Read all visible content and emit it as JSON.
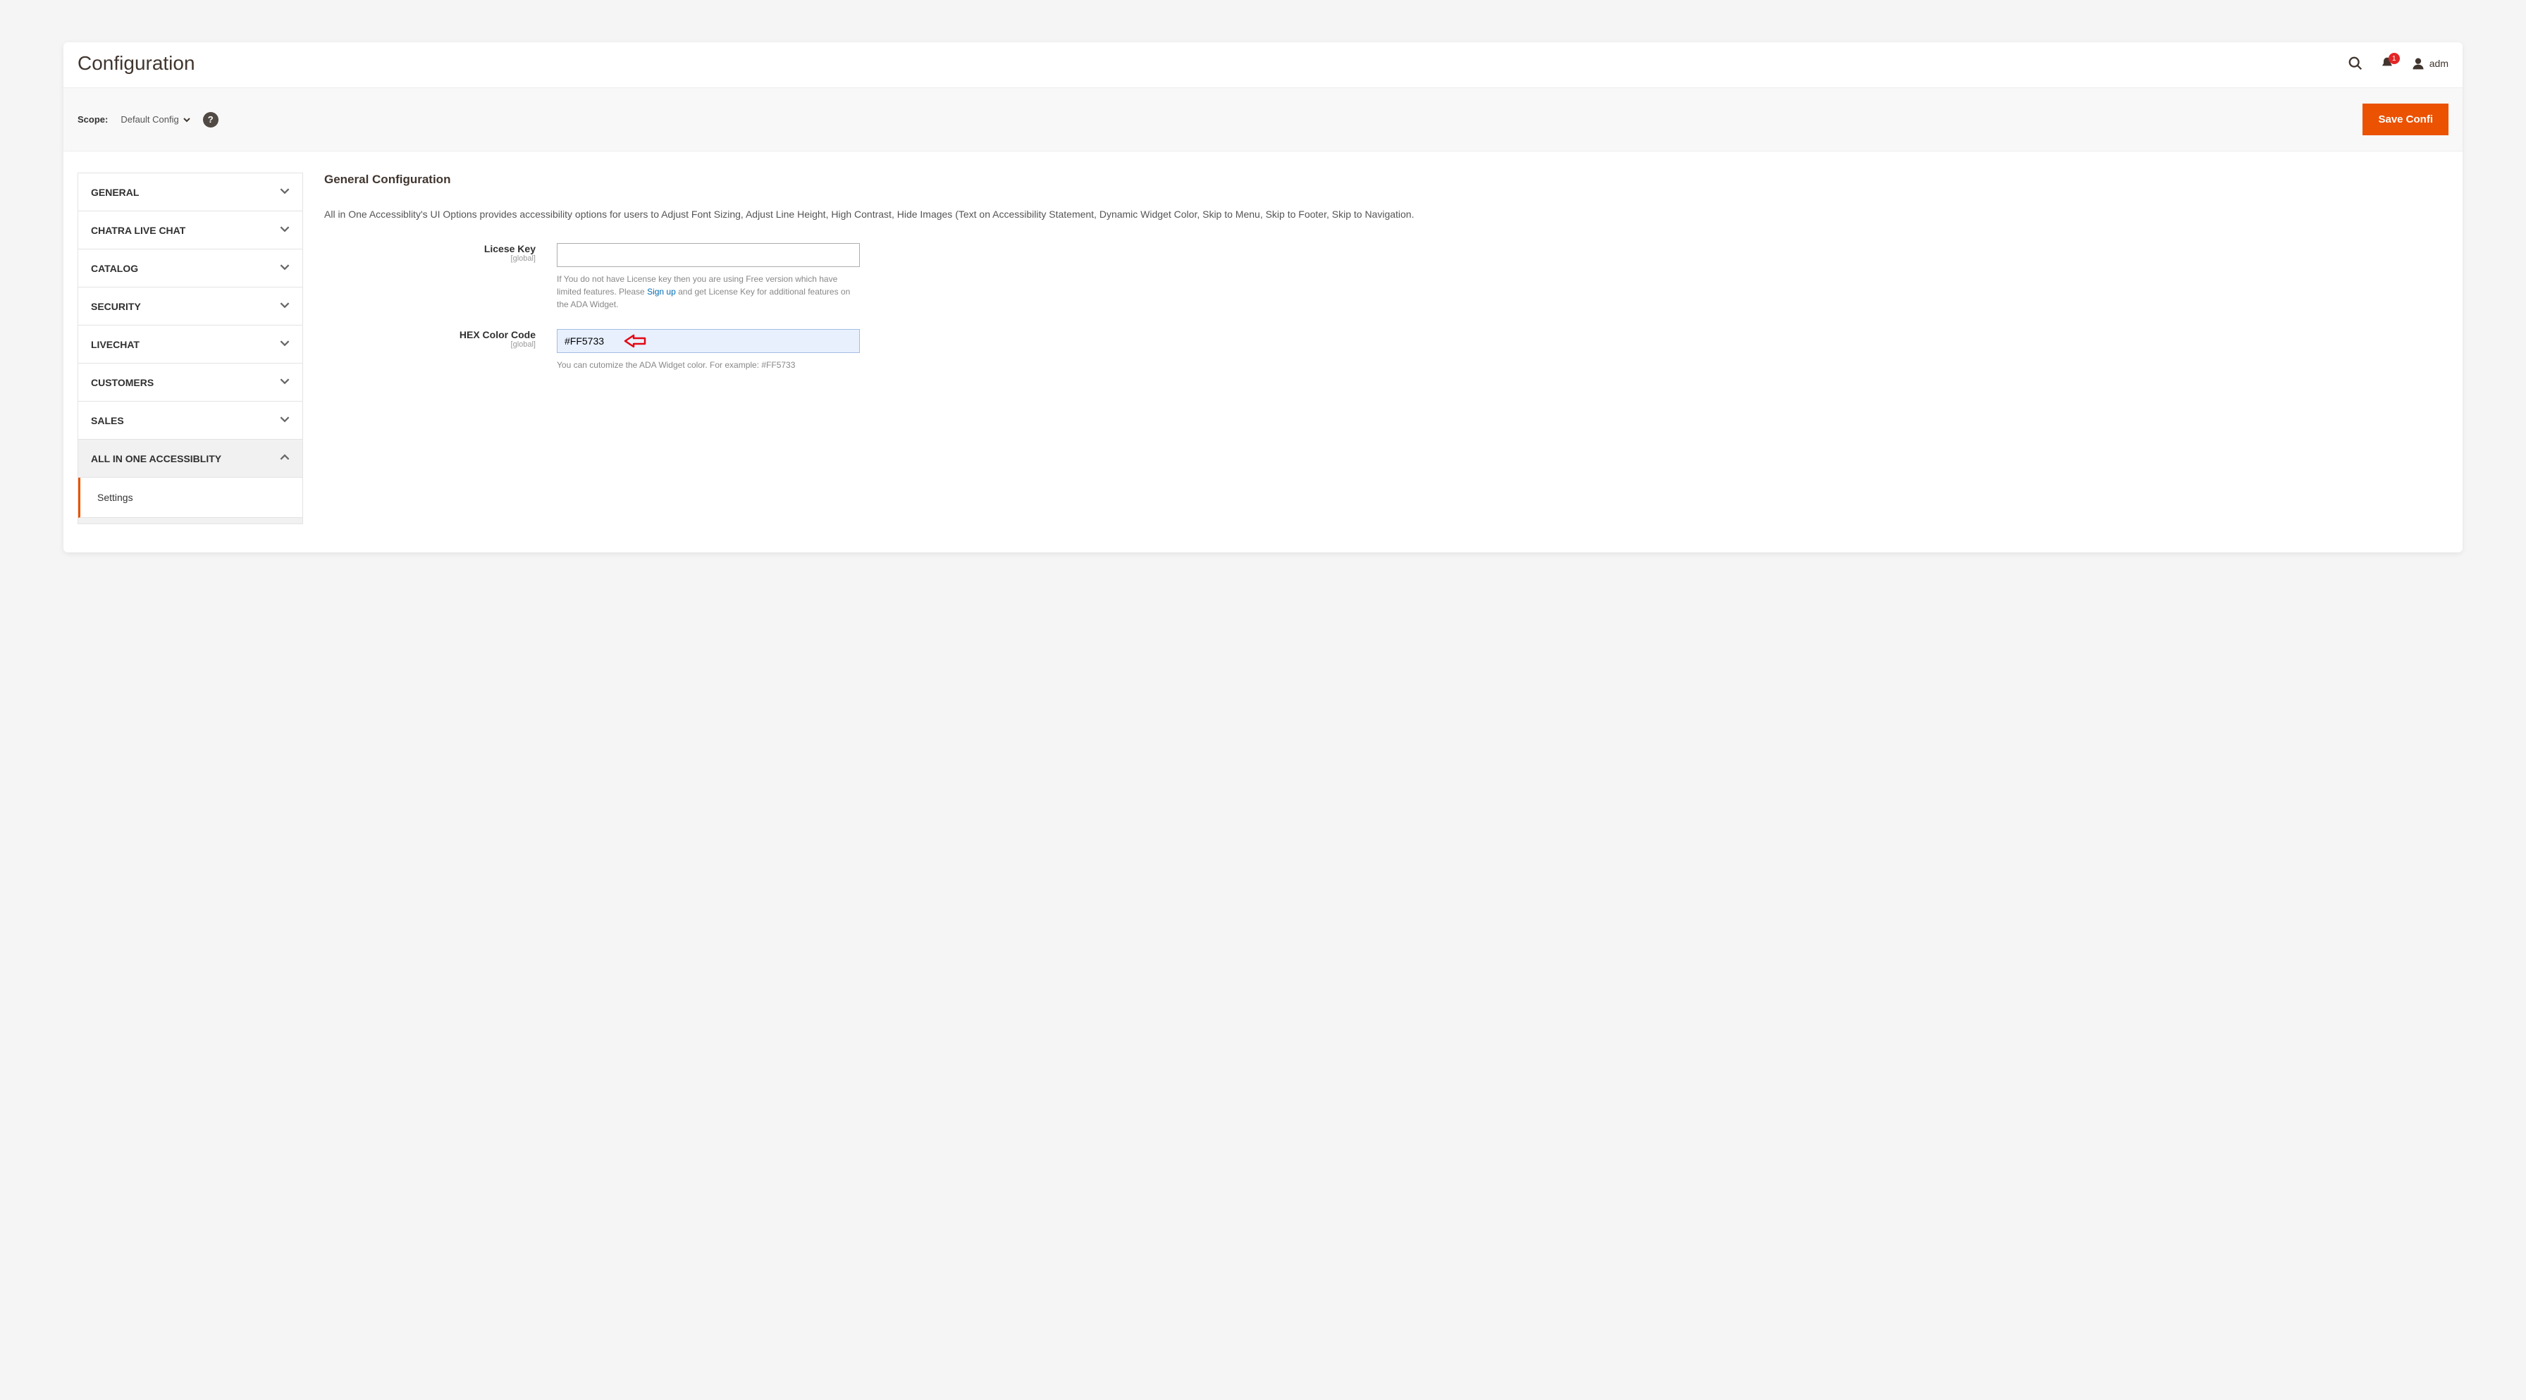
{
  "header": {
    "title": "Configuration",
    "notification_count": "1",
    "username": "adm"
  },
  "scope_bar": {
    "label": "Scope:",
    "selected": "Default Config",
    "save_button": "Save Confi"
  },
  "sidebar": {
    "items": [
      {
        "label": "GENERAL",
        "expanded": false
      },
      {
        "label": "CHATRA LIVE CHAT",
        "expanded": false
      },
      {
        "label": "CATALOG",
        "expanded": false
      },
      {
        "label": "SECURITY",
        "expanded": false
      },
      {
        "label": "LIVECHAT",
        "expanded": false
      },
      {
        "label": "CUSTOMERS",
        "expanded": false
      },
      {
        "label": "SALES",
        "expanded": false
      },
      {
        "label": "ALL IN ONE ACCESSIBLITY",
        "expanded": true
      }
    ],
    "sub_item": "Settings"
  },
  "main": {
    "section_title": "General Configuration",
    "description": "All in One Accessiblity's UI Options provides accessibility options for users to Adjust Font Sizing, Adjust Line Height, High Contrast, Hide Images (Text on Accessibility Statement, Dynamic Widget Color, Skip to Menu, Skip to Footer, Skip to Navigation.",
    "fields": {
      "license": {
        "label": "Licese Key",
        "scope": "[global]",
        "value": "",
        "hint_pre": "If You do not have License key then you are using Free version which have limited features. Please ",
        "hint_link": "Sign up",
        "hint_post": " and get License Key for additional features on the ADA Widget."
      },
      "hex": {
        "label": "HEX Color Code",
        "scope": "[global]",
        "value": "#FF5733",
        "hint": "You can cutomize the ADA Widget color. For example: #FF5733"
      }
    }
  }
}
